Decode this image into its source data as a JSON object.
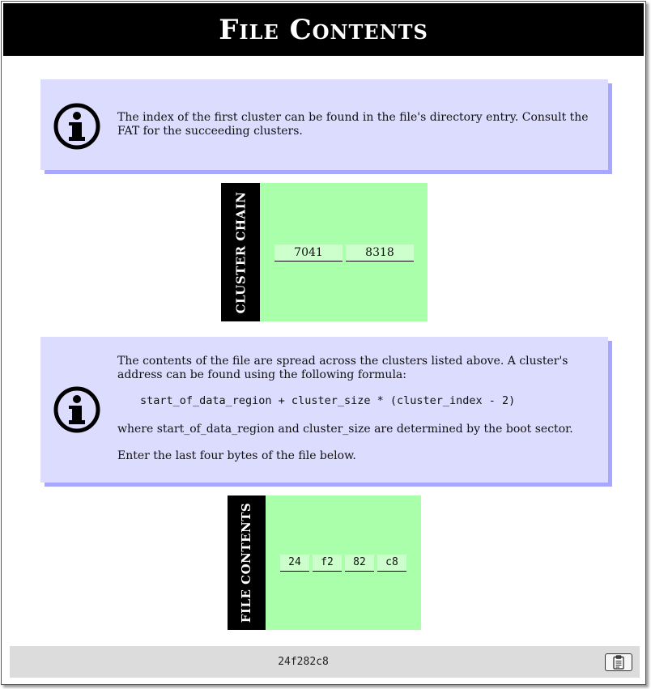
{
  "title": "File Contents",
  "info1": {
    "icon": "info-icon",
    "text": "The index of the first cluster can be found in the file's directory entry. Consult the FAT for the succeeding clusters."
  },
  "cluster_chain": {
    "label": "CLUSTER CHAIN",
    "values": [
      "7041",
      "8318"
    ]
  },
  "info2": {
    "icon": "info-icon",
    "paragraph1": "The contents of the file are spread across the clusters listed above. A cluster's address can be found using the following formula:",
    "formula": "start_of_data_region + cluster_size * (cluster_index - 2)",
    "paragraph2": "where start_of_data_region and cluster_size are determined by the boot sector.",
    "paragraph3": "Enter the last four bytes of the file below."
  },
  "file_contents": {
    "label": "FILE CONTENTS",
    "bytes": [
      "24",
      "f2",
      "82",
      "c8"
    ]
  },
  "footer": {
    "value": "24f282c8",
    "copy_icon": "clipboard-icon"
  },
  "colors": {
    "title_bar": "#000000",
    "info_background": "#dcdcfe",
    "info_shadow": "#a7a7ff",
    "panel_background": "#aaffaa",
    "cell_background": "#ccffcc",
    "footer_background": "#dcdcdc"
  }
}
